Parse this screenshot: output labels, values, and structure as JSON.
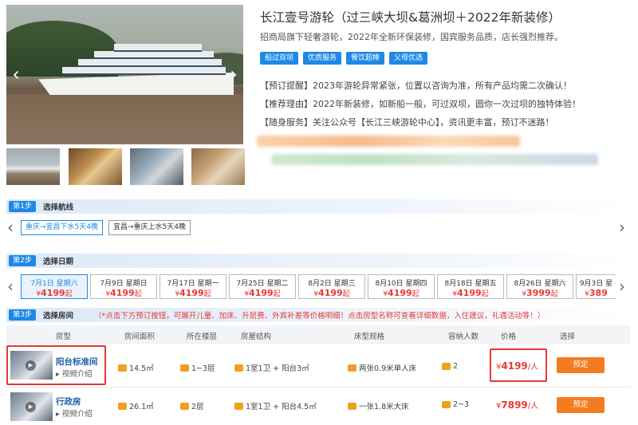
{
  "product": {
    "title": "长江壹号游轮（过三峡大坝&葛洲坝＋2022年新装修）",
    "subtitle": "招商局旗下轻奢游轮，2022年全新环保装修，国宾服务品质，店长强烈推荐。",
    "tags": [
      "船过双坝",
      "优质服务",
      "餐饮超棒",
      "父母优选"
    ],
    "notes": [
      "【预订提醒】2023年游轮异常紧张，位置以咨询为准，所有产品均需二次确认！",
      "【推荐理由】2022年新装修，如新船一般，可过双坝，圆你一次过坝的独特体验！",
      "【随身服务】关注公众号【长江三峡游轮中心】，资讯更丰富，预订不迷路！"
    ]
  },
  "gallery": {
    "thumbs": [
      "ship-exterior",
      "atrium",
      "lounge",
      "restaurant"
    ]
  },
  "step1": {
    "badge": "第1步",
    "label": "选择航线",
    "routes": [
      {
        "label": "重庆→宜昌下水5天4晚",
        "selected": true
      },
      {
        "label": "宜昌→重庆上水5天4晚",
        "selected": false
      }
    ]
  },
  "step2": {
    "badge": "第2步",
    "label": "选择日期",
    "dates": [
      {
        "date": "7月1日 星期六",
        "price": "4199",
        "suffix": "起",
        "selected": true
      },
      {
        "date": "7月9日 星期日",
        "price": "4199",
        "suffix": "起"
      },
      {
        "date": "7月17日 星期一",
        "price": "4199",
        "suffix": "起"
      },
      {
        "date": "7月25日 星期二",
        "price": "4199",
        "suffix": "起"
      },
      {
        "date": "8月2日 星期三",
        "price": "4199",
        "suffix": "起"
      },
      {
        "date": "8月10日 星期四",
        "price": "4199",
        "suffix": "起"
      },
      {
        "date": "8月18日 星期五",
        "price": "4199",
        "suffix": "起"
      },
      {
        "date": "8月26日 星期六",
        "price": "3999",
        "suffix": "起"
      },
      {
        "date": "9月3日 星",
        "price": "389",
        "suffix": ""
      }
    ]
  },
  "step3": {
    "badge": "第3步",
    "label": "选择房间",
    "hint": "（*点击下方预订按钮，可展开儿童、加床、升层费、外宾补差等价格明细！点击房型名称可查看详细数据，入住建议，礼遇活动等！）"
  },
  "table": {
    "headers": [
      "房型",
      "房间面积",
      "所在楼层",
      "房屋结构",
      "床型规格",
      "容纳人数",
      "价格",
      "选择"
    ],
    "rows": [
      {
        "name": "阳台标准间",
        "video": "视频介绍",
        "area": "14.5㎡",
        "floor": "1~3层",
        "structure": "1室1卫 + 阳台3㎡",
        "bed": "两张0.9米单人床",
        "capacity": "2",
        "currency": "¥",
        "price": "4199",
        "unit": "/人",
        "book": "预定"
      },
      {
        "name": "行政房",
        "video": "视频介绍",
        "area": "26.1㎡",
        "floor": "2层",
        "structure": "1室1卫 + 阳台4.5㎡",
        "bed": "一张1.8米大床",
        "capacity": "2~3",
        "currency": "¥",
        "price": "7899",
        "unit": "/人",
        "book": "预定"
      }
    ]
  },
  "colors": {
    "accent": "#1e88e5",
    "price": "#e53935",
    "book": "#f47c20"
  }
}
